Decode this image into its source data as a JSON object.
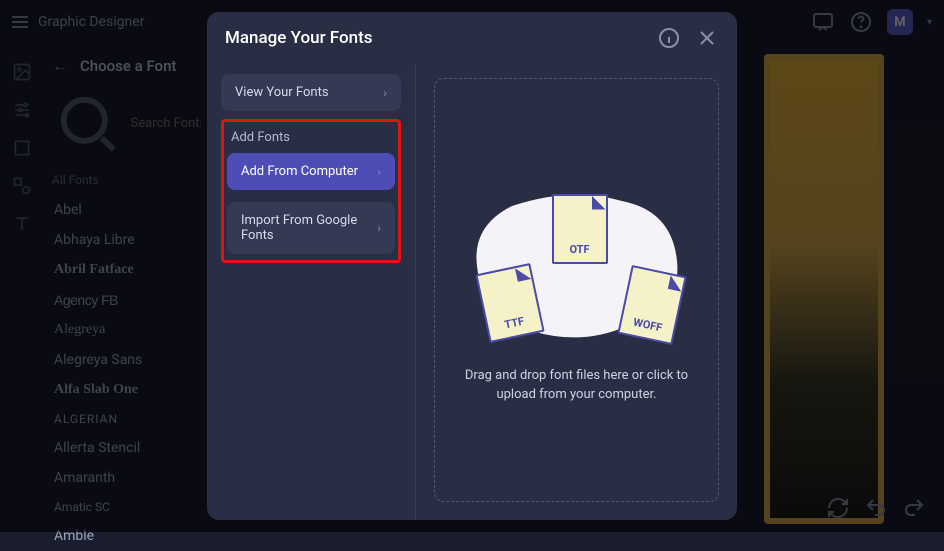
{
  "topbar": {
    "app_title": "Graphic Designer",
    "avatar_letter": "M"
  },
  "font_panel": {
    "title": "Choose a Font",
    "search_placeholder": "Search Fonts",
    "all_fonts_label": "All Fonts",
    "fonts": [
      "Abel",
      "Abhaya Libre",
      "Abril Fatface",
      "Agency FB",
      "Alegreya",
      "Alegreya Sans",
      "Alfa Slab One",
      "ALGERIAN",
      "Allerta Stencil",
      "Amaranth",
      "Amatic SC",
      "Amble"
    ]
  },
  "modal": {
    "title": "Manage Your Fonts",
    "view_fonts_label": "View Your Fonts",
    "add_fonts_section": "Add Fonts",
    "add_from_computer": "Add From Computer",
    "import_google": "Import From Google Fonts",
    "file_types": {
      "ttf": "TTF",
      "otf": "OTF",
      "woff": "WOFF"
    },
    "drop_text": "Drag and drop font files here or click to upload from your computer."
  }
}
